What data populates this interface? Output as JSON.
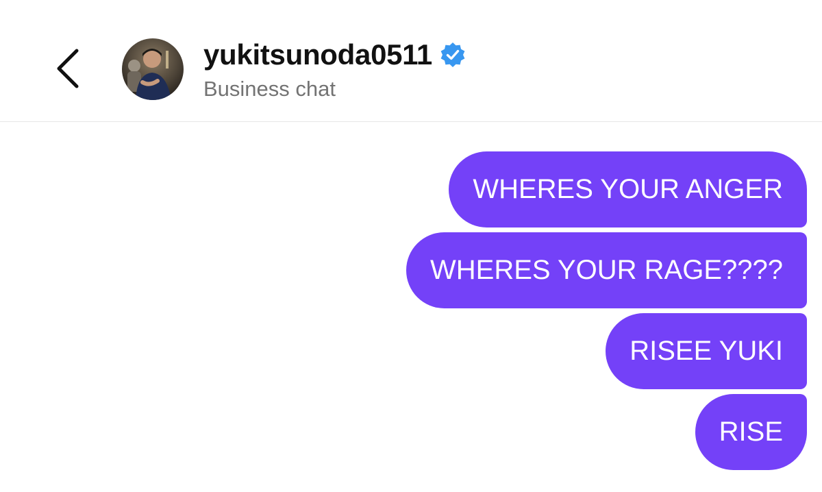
{
  "header": {
    "username": "yukitsunoda0511",
    "subtitle": "Business chat",
    "verified": true,
    "verified_color": "#3897f0",
    "back_icon": "chevron-left-icon"
  },
  "messages": [
    {
      "text": "WHERES YOUR ANGER"
    },
    {
      "text": "WHERES YOUR RAGE????"
    },
    {
      "text": "RISEE YUKI"
    },
    {
      "text": "RISE"
    }
  ],
  "colors": {
    "bubble": "#7441f8",
    "bubble_text": "#ffffff",
    "subtitle": "#737373"
  }
}
